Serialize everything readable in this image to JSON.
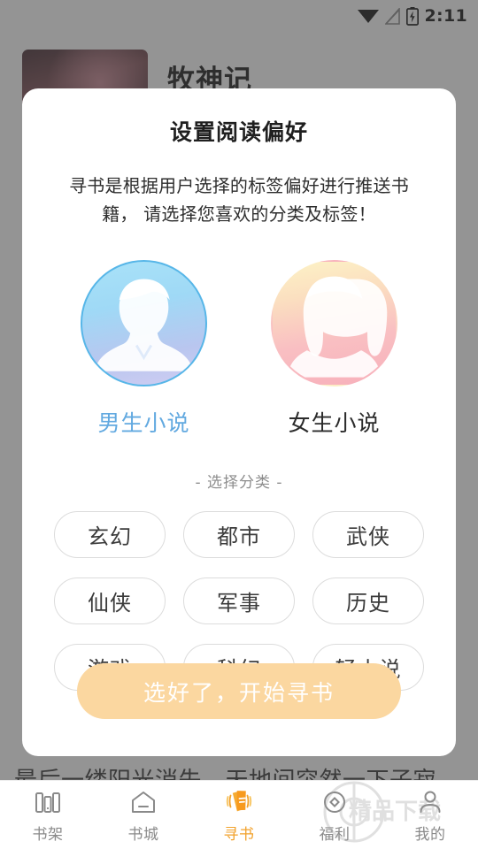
{
  "status_bar": {
    "time": "2:11",
    "icons": [
      "wifi-icon",
      "no-signal-icon",
      "battery-charging-icon"
    ]
  },
  "background": {
    "book_title": "牧神记",
    "cover_alt": "book-cover",
    "paragraph": "最后一缕阳光消失，天地间突然一下子寂"
  },
  "modal": {
    "title": "设置阅读偏好",
    "description": "寻书是根据用户选择的标签偏好进行推送书籍， 请选择您喜欢的分类及标签！",
    "gender": {
      "options": [
        {
          "label": "男生小说",
          "selected": true,
          "avatar": "male-avatar-icon"
        },
        {
          "label": "女生小说",
          "selected": false,
          "avatar": "female-avatar-icon"
        }
      ]
    },
    "category": {
      "heading": "- 选择分类 -",
      "items": [
        {
          "label": "玄幻",
          "selected": false
        },
        {
          "label": "都市",
          "selected": false
        },
        {
          "label": "武侠",
          "selected": false
        },
        {
          "label": "仙侠",
          "selected": false
        },
        {
          "label": "军事",
          "selected": false
        },
        {
          "label": "历史",
          "selected": false
        },
        {
          "label": "游戏",
          "selected": false
        },
        {
          "label": "科幻",
          "selected": false
        },
        {
          "label": "轻小说",
          "selected": false
        }
      ]
    },
    "cta_label": "选好了，开始寻书"
  },
  "bottom_nav": {
    "items": [
      {
        "label": "书架",
        "icon": "bookshelf-icon",
        "active": false
      },
      {
        "label": "书城",
        "icon": "home-icon",
        "active": false
      },
      {
        "label": "寻书",
        "icon": "find-book-icon",
        "active": true
      },
      {
        "label": "福利",
        "icon": "coin-icon",
        "active": false
      },
      {
        "label": "我的",
        "icon": "person-icon",
        "active": false
      }
    ]
  },
  "watermark": {
    "text": "精品下载"
  },
  "colors": {
    "accent_orange": "#f2a22c",
    "cta_bg": "#fbd7a0",
    "selected_blue": "#62a9e0",
    "chip_border": "#dcdcdc",
    "scrim": "rgba(60,60,60,0.55)"
  }
}
